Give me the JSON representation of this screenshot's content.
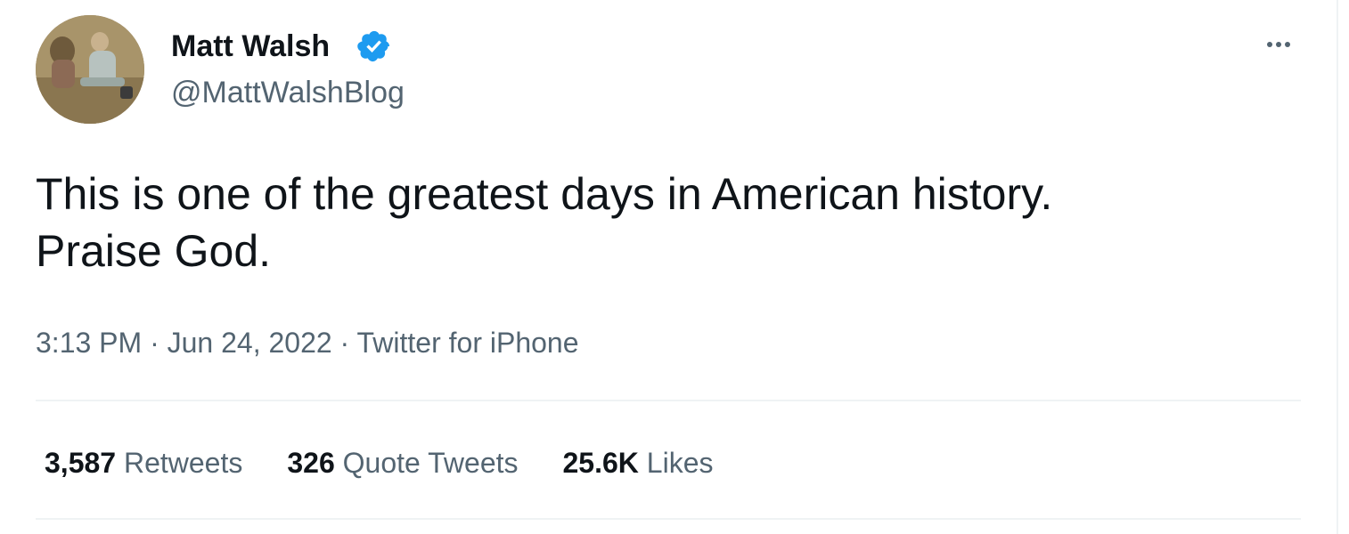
{
  "tweet": {
    "display_name": "Matt Walsh",
    "handle": "@MattWalshBlog",
    "verified_icon": "verified-badge-icon",
    "more_icon": "more-options-icon",
    "text_line1": "This is one of the greatest days in American history.",
    "text_line2": "Praise God.",
    "time": "3:13 PM",
    "sep1": "·",
    "date": "Jun 24, 2022",
    "sep2": "·",
    "source": "Twitter for iPhone"
  },
  "stats": {
    "retweets_count": "3,587",
    "retweets_label": "Retweets",
    "quotes_count": "326",
    "quotes_label": "Quote Tweets",
    "likes_count": "25.6K",
    "likes_label": "Likes"
  },
  "colors": {
    "text_primary": "#0f1419",
    "text_secondary": "#536471",
    "verified_blue": "#1d9bf0",
    "divider": "#eff3f4"
  }
}
